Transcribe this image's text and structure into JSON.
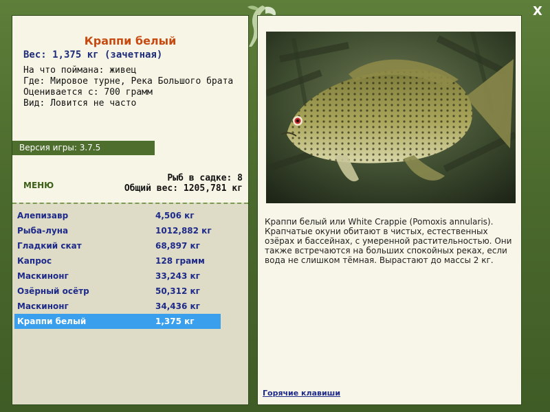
{
  "window": {
    "close_label": "X"
  },
  "fish": {
    "title": "Краппи белый",
    "weight_line": "Вес: 1,375 кг (зачетная)",
    "info": [
      "На что поймана: живец",
      "Где: Мировое турне, Река Большого брата",
      "Оценивается с: 700 грамм",
      "Вид: Ловится не часто"
    ]
  },
  "version": "Версия игры: 3.7.5",
  "menu_label": "МЕНЮ",
  "stats": {
    "fish_in_keepnet": "Рыб в садке: 8",
    "total_weight": "Общий вес: 1205,781 кг"
  },
  "catch_list": [
    {
      "name": "Алепизавр",
      "weight": "4,506 кг"
    },
    {
      "name": "Рыба-луна",
      "weight": "1012,882 кг"
    },
    {
      "name": "Гладкий скат",
      "weight": "68,897 кг"
    },
    {
      "name": "Капрос",
      "weight": "128 грамм"
    },
    {
      "name": "Маскинонг",
      "weight": "33,243 кг"
    },
    {
      "name": "Озёрный осётр",
      "weight": "50,312 кг"
    },
    {
      "name": "Маскинонг",
      "weight": "34,436 кг"
    },
    {
      "name": "Краппи белый",
      "weight": "1,375 кг",
      "selected": true
    }
  ],
  "description": "Краппи белый или White Crappie (Pomoxis annularis). Крапчатые окуни обитают в чистых, естественных озёрах и бассейнах, с умеренной растительностью. Они также встречаются на больших спокойных реках, если вода не слишком тёмная. Вырастают до массы 2 кг.",
  "hotkeys_label": "Горячие клавиши",
  "colors": {
    "frame": "#4b6a2d",
    "selected_row": "#3aa0ee",
    "title": "#c74a10",
    "link": "#1e2a8a"
  }
}
